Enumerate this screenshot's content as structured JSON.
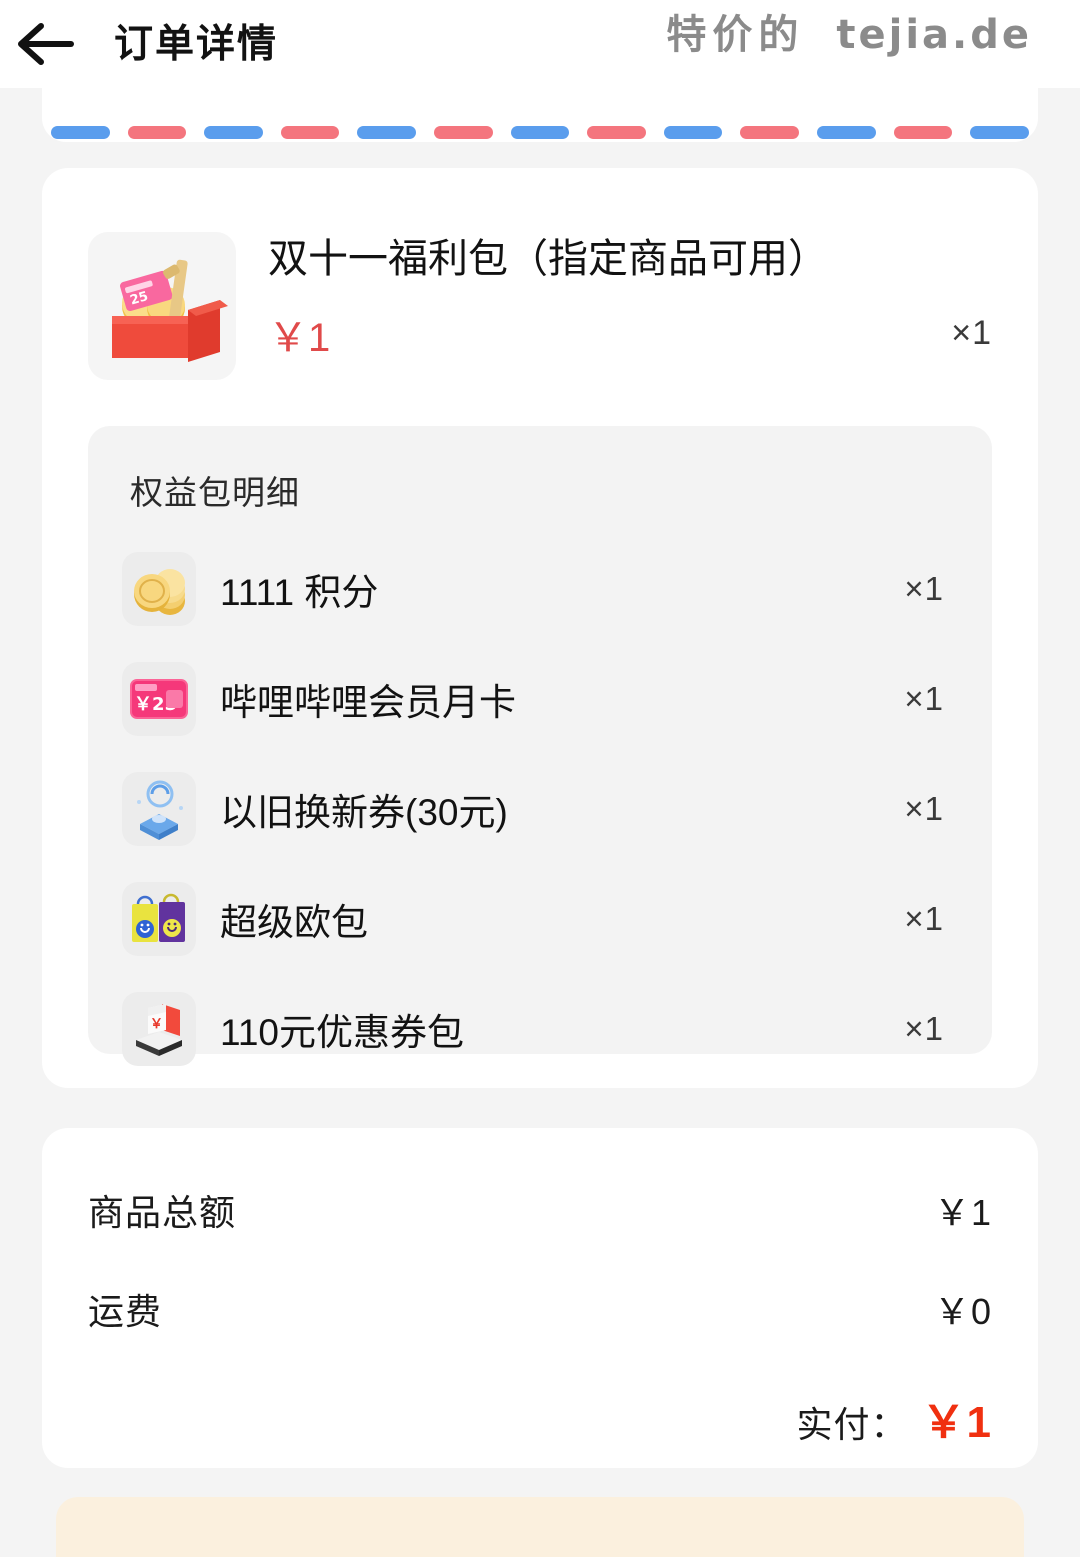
{
  "navbar": {
    "back_icon": "arrow-left-icon",
    "title": "订单详情"
  },
  "watermark": {
    "cn": "特价的",
    "en": "tejia.de"
  },
  "envelope": {
    "stripe_colors": [
      "#5a9ded",
      "#f4757e"
    ],
    "stripe_count": 13
  },
  "product": {
    "thumb_icon": "red-gift-box-icon",
    "title": "双十一福利包（指定商品可用）",
    "price": "￥1",
    "quantity": "×1"
  },
  "benefits": {
    "title": "权益包明细",
    "items": [
      {
        "icon": "gold-coins-icon",
        "label": "1111 积分",
        "quantity": "×1"
      },
      {
        "icon": "bilibili-card-icon",
        "label": "哔哩哔哩会员月卡",
        "quantity": "×1"
      },
      {
        "icon": "trade-in-icon",
        "label": "以旧换新券(30元)",
        "quantity": "×1"
      },
      {
        "icon": "tote-bags-icon",
        "label": "超级欧包",
        "quantity": "×1"
      },
      {
        "icon": "coupon-pack-icon",
        "label": "110元优惠券包",
        "quantity": "×1"
      }
    ]
  },
  "summary": {
    "rows": [
      {
        "label": "商品总额",
        "value": "￥1"
      },
      {
        "label": "运费",
        "value": "￥0"
      }
    ],
    "total_label": "实付：",
    "total_value": "￥1",
    "total_color": "#f03010"
  },
  "colors": {
    "page_bg": "#f4f4f4",
    "card_bg": "#ffffff",
    "panel_bg": "#f3f3f3",
    "price_red": "#e04a4a",
    "total_red": "#f03010",
    "stripe_blue": "#5a9ded",
    "stripe_red": "#f4757e",
    "bottom_card": "#fbf0de"
  }
}
